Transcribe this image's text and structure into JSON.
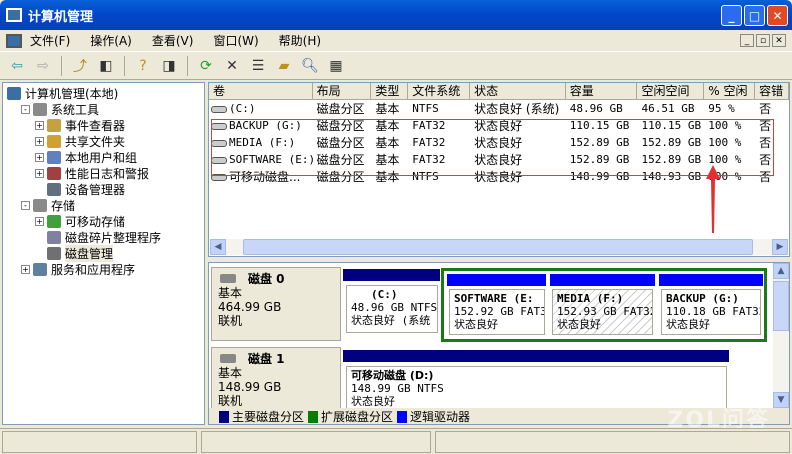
{
  "window": {
    "title": "计算机管理"
  },
  "menu": [
    "文件(F)",
    "操作(A)",
    "查看(V)",
    "窗口(W)",
    "帮助(H)"
  ],
  "toolbar": [
    "back-icon",
    "forward-icon",
    "up-folder-icon",
    "show-hide-tree-icon",
    "help-icon",
    "action-pane-icon",
    "refresh-icon",
    "delete-icon",
    "properties-icon",
    "open-icon",
    "search-icon",
    "settings-icon"
  ],
  "tree": [
    {
      "label": "计算机管理(本地)",
      "level": 0,
      "exp": ""
    },
    {
      "label": "系统工具",
      "level": 1,
      "exp": "-"
    },
    {
      "label": "事件查看器",
      "level": 2,
      "exp": "+"
    },
    {
      "label": "共享文件夹",
      "level": 2,
      "exp": "+"
    },
    {
      "label": "本地用户和组",
      "level": 2,
      "exp": "+"
    },
    {
      "label": "性能日志和警报",
      "level": 2,
      "exp": "+"
    },
    {
      "label": "设备管理器",
      "level": 2,
      "exp": ""
    },
    {
      "label": "存储",
      "level": 1,
      "exp": "-"
    },
    {
      "label": "可移动存储",
      "level": 2,
      "exp": "+"
    },
    {
      "label": "磁盘碎片整理程序",
      "level": 2,
      "exp": ""
    },
    {
      "label": "磁盘管理",
      "level": 2,
      "exp": ""
    },
    {
      "label": "服务和应用程序",
      "level": 1,
      "exp": "+"
    }
  ],
  "table": {
    "columns": [
      "卷",
      "布局",
      "类型",
      "文件系统",
      "状态",
      "容量",
      "空闲空间",
      "% 空闲",
      "容错"
    ],
    "rows": [
      [
        "(C:)",
        "磁盘分区",
        "基本",
        "NTFS",
        "状态良好 (系统)",
        "48.96 GB",
        "46.51 GB",
        "95 %",
        "否"
      ],
      [
        "BACKUP (G:)",
        "磁盘分区",
        "基本",
        "FAT32",
        "状态良好",
        "110.15 GB",
        "110.15 GB",
        "100 %",
        "否"
      ],
      [
        "MEDIA (F:)",
        "磁盘分区",
        "基本",
        "FAT32",
        "状态良好",
        "152.89 GB",
        "152.89 GB",
        "100 %",
        "否"
      ],
      [
        "SOFTWARE (E:)",
        "磁盘分区",
        "基本",
        "FAT32",
        "状态良好",
        "152.89 GB",
        "152.89 GB",
        "100 %",
        "否"
      ],
      [
        "可移动磁盘...",
        "磁盘分区",
        "基本",
        "NTFS",
        "状态良好",
        "148.99 GB",
        "148.93 GB",
        "100 %",
        "否"
      ]
    ]
  },
  "disks": [
    {
      "name": "磁盘 0",
      "type": "基本",
      "size": "464.99 GB",
      "state": "联机",
      "parts": [
        {
          "title": "(C:)",
          "info": "48.96 GB NTFS",
          "status": "状态良好 (系统"
        },
        {
          "title": "SOFTWARE (E:",
          "info": "152.92 GB FAT32",
          "status": "状态良好"
        },
        {
          "title": "MEDIA (F:)",
          "info": "152.93 GB FAT32",
          "status": "状态良好"
        },
        {
          "title": "BACKUP (G:)",
          "info": "110.18 GB FAT32",
          "status": "状态良好"
        }
      ]
    },
    {
      "name": "磁盘 1",
      "type": "基本",
      "size": "148.99 GB",
      "state": "联机",
      "parts": [
        {
          "title": "可移动磁盘 (D:)",
          "info": "148.99 GB NTFS",
          "status": "状态良好"
        }
      ]
    }
  ],
  "legend": [
    {
      "label": "主要磁盘分区",
      "color": "#000080"
    },
    {
      "label": "扩展磁盘分区",
      "color": "#008000"
    },
    {
      "label": "逻辑驱动器",
      "color": "#0000ff"
    }
  ],
  "watermark": "ZOL问答",
  "colors": {
    "primary": "#000080",
    "extended": "#1a7a1a",
    "logical": "#0000ff",
    "highlight": "#d04040",
    "arrow": "#e03030"
  }
}
